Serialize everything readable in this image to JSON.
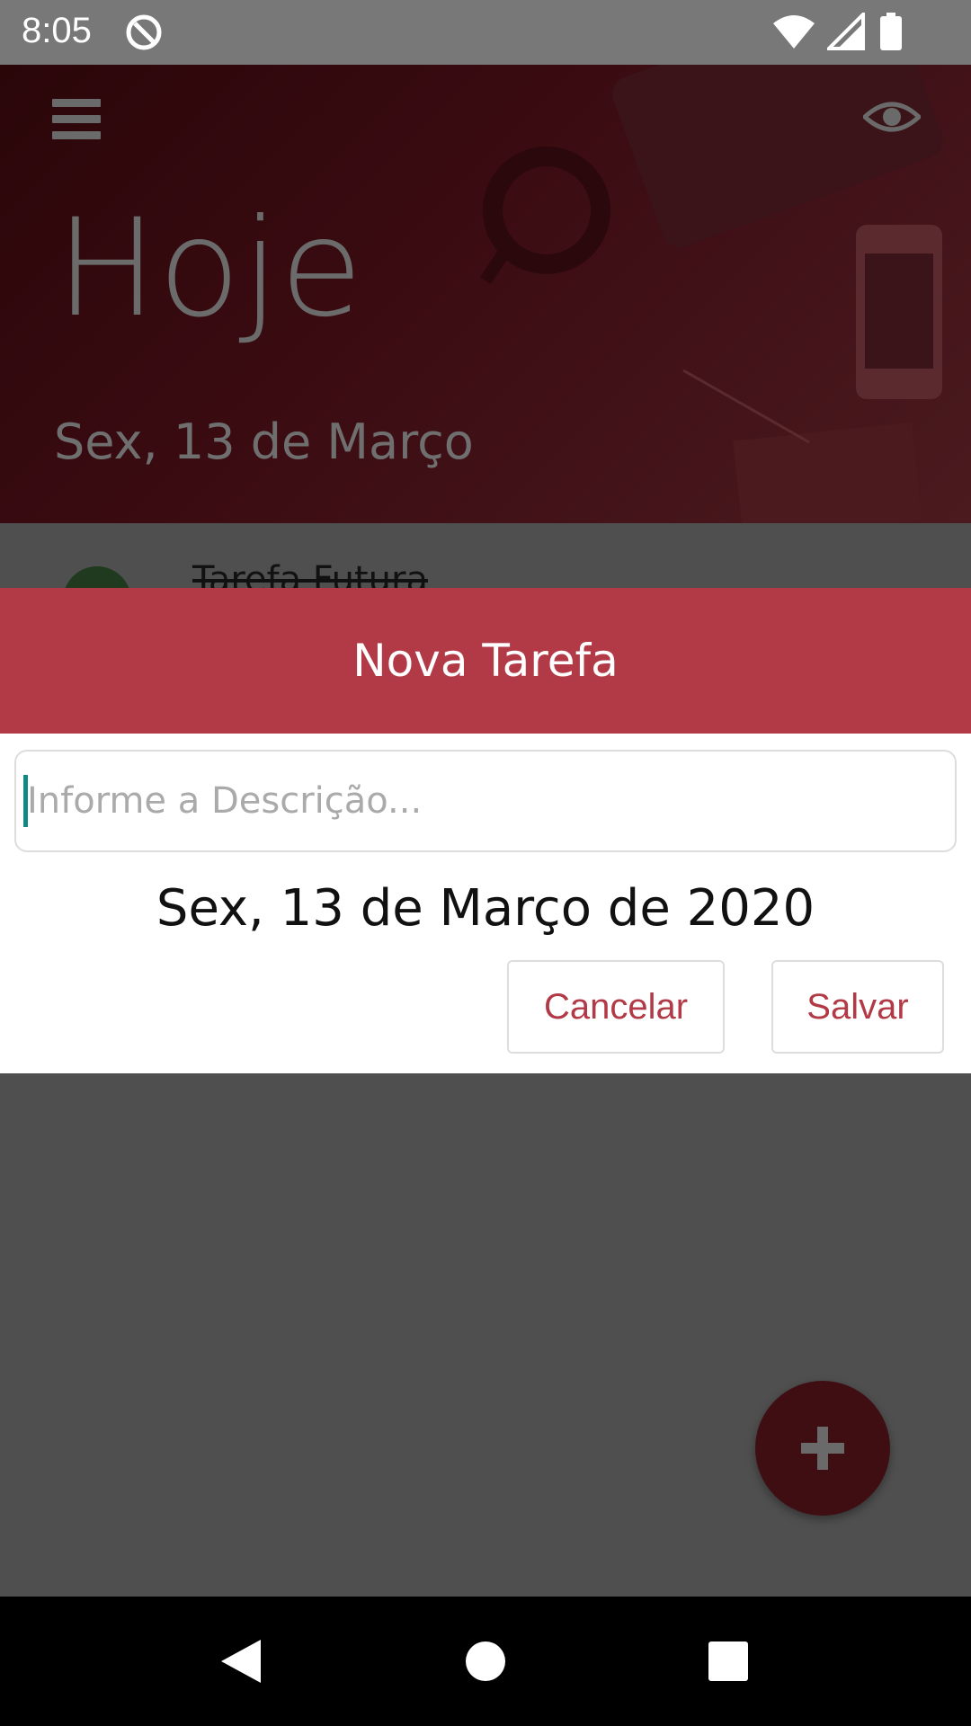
{
  "status_bar": {
    "time": "8:05",
    "icons": [
      "app-notification-icon",
      "wifi-icon",
      "cellular-signal-icon",
      "battery-icon"
    ]
  },
  "header": {
    "title": "Hoje",
    "date": "Sex, 13 de Março",
    "icons": [
      "menu-icon",
      "eye-icon"
    ]
  },
  "list": {
    "items": [
      {
        "label": "Tarefa Futura",
        "done": true
      }
    ]
  },
  "dialog": {
    "title": "Nova Tarefa",
    "description_placeholder": "Informe a Descrição...",
    "description_value": "",
    "date": "Sex, 13 de Março de 2020",
    "cancel_label": "Cancelar",
    "save_label": "Salvar"
  },
  "fab": {
    "icon": "plus-icon"
  },
  "nav_bar": {
    "icons": [
      "back-icon",
      "home-icon",
      "recents-icon"
    ]
  },
  "colors": {
    "accent": "#b23a46",
    "header_bg": "#3b0c12",
    "overlay": "#4d4d4d",
    "caret": "#0f8a83"
  }
}
